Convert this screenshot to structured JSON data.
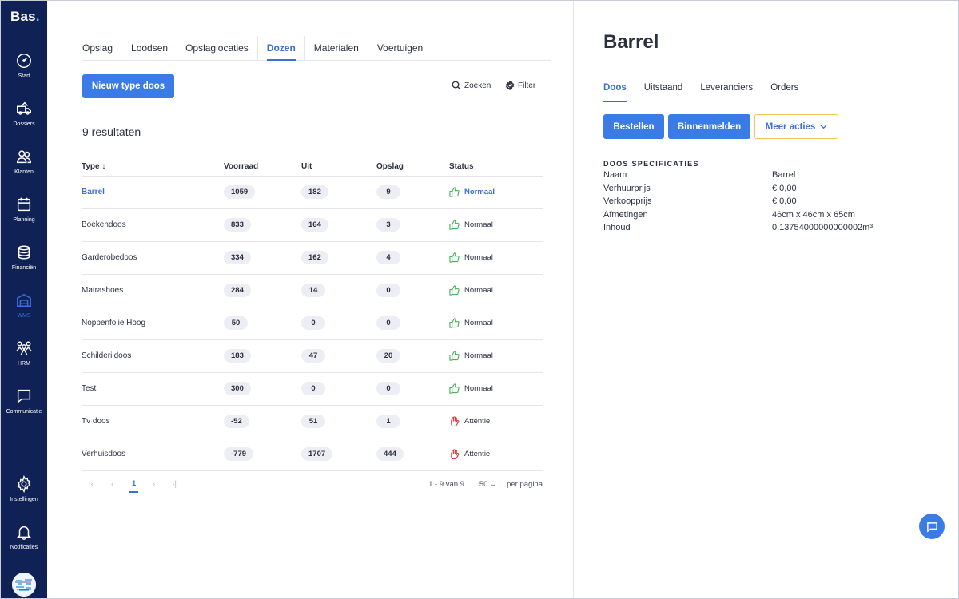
{
  "app": {
    "logo": "Bas",
    "logo_dot": "."
  },
  "sidebar": {
    "items": [
      {
        "label": "Start",
        "icon": "gauge-icon"
      },
      {
        "label": "Dossiers",
        "icon": "truck-icon"
      },
      {
        "label": "Klanten",
        "icon": "users-icon"
      },
      {
        "label": "Planning",
        "icon": "calendar-icon"
      },
      {
        "label": "Financiën",
        "icon": "coins-icon"
      },
      {
        "label": "WMS",
        "icon": "warehouse-icon",
        "active": true
      },
      {
        "label": "HRM",
        "icon": "team-icon"
      },
      {
        "label": "Communicatie",
        "icon": "chat-icon"
      },
      {
        "label": "Instellingen",
        "icon": "gear-icon"
      },
      {
        "label": "Notificaties",
        "icon": "bell-icon"
      }
    ]
  },
  "main": {
    "tabs": [
      {
        "label": "Opslag"
      },
      {
        "label": "Loodsen"
      },
      {
        "label": "Opslaglocaties"
      },
      {
        "label": "Dozen",
        "active": true
      },
      {
        "label": "Materialen"
      },
      {
        "label": "Voertuigen"
      }
    ],
    "new_button": "Nieuw type doos",
    "search_label": "Zoeken",
    "filter_label": "Filter",
    "results": "9 resultaten",
    "columns": {
      "type": "Type",
      "sort_arrow": "↓",
      "voorraad": "Voorraad",
      "uit": "Uit",
      "opslag": "Opslag",
      "status": "Status"
    },
    "rows": [
      {
        "type": "Barrel",
        "voorraad": "1059",
        "uit": "182",
        "opslag": "9",
        "status": "Normaal",
        "state": "ok",
        "selected": true
      },
      {
        "type": "Boekendoos",
        "voorraad": "833",
        "uit": "164",
        "opslag": "3",
        "status": "Normaal",
        "state": "ok"
      },
      {
        "type": "Garderobedoos",
        "voorraad": "334",
        "uit": "162",
        "opslag": "4",
        "status": "Normaal",
        "state": "ok"
      },
      {
        "type": "Matrashoes",
        "voorraad": "284",
        "uit": "14",
        "opslag": "0",
        "status": "Normaal",
        "state": "ok"
      },
      {
        "type": "Noppenfolie Hoog",
        "voorraad": "50",
        "uit": "0",
        "opslag": "0",
        "status": "Normaal",
        "state": "ok"
      },
      {
        "type": "Schilderijdoos",
        "voorraad": "183",
        "uit": "47",
        "opslag": "20",
        "status": "Normaal",
        "state": "ok"
      },
      {
        "type": "Test",
        "voorraad": "300",
        "uit": "0",
        "opslag": "0",
        "status": "Normaal",
        "state": "ok"
      },
      {
        "type": "Tv doos",
        "voorraad": "-52",
        "uit": "51",
        "opslag": "1",
        "status": "Attentie",
        "state": "warn"
      },
      {
        "type": "Verhuisdoos",
        "voorraad": "-779",
        "uit": "1707",
        "opslag": "444",
        "status": "Attentie",
        "state": "warn"
      }
    ],
    "pager": {
      "page": "1",
      "range": "1 - 9 van 9",
      "page_size": "50",
      "per_page": "per pagina"
    }
  },
  "detail": {
    "title": "Barrel",
    "tabs": [
      {
        "label": "Doos",
        "active": true
      },
      {
        "label": "Uitstaand"
      },
      {
        "label": "Leveranciers"
      },
      {
        "label": "Orders"
      }
    ],
    "actions": {
      "order": "Bestellen",
      "report_in": "Binnenmelden",
      "more": "Meer acties"
    },
    "spec_heading": "DOOS SPECIFICATIES",
    "specs": [
      {
        "key": "Naam",
        "value": "Barrel"
      },
      {
        "key": "Verhuurprijs",
        "value": "€ 0,00"
      },
      {
        "key": "Verkoopprijs",
        "value": "€ 0,00"
      },
      {
        "key": "Afmetingen",
        "value": "46cm x 46cm x 65cm"
      },
      {
        "key": "Inhoud",
        "value": "0.13754000000000002m³"
      }
    ]
  },
  "colors": {
    "sidebar": "#0f2155",
    "accent": "#3b7be6",
    "ok": "#47b05a",
    "warn": "#e03a3a",
    "outline": "#f1c45a"
  }
}
